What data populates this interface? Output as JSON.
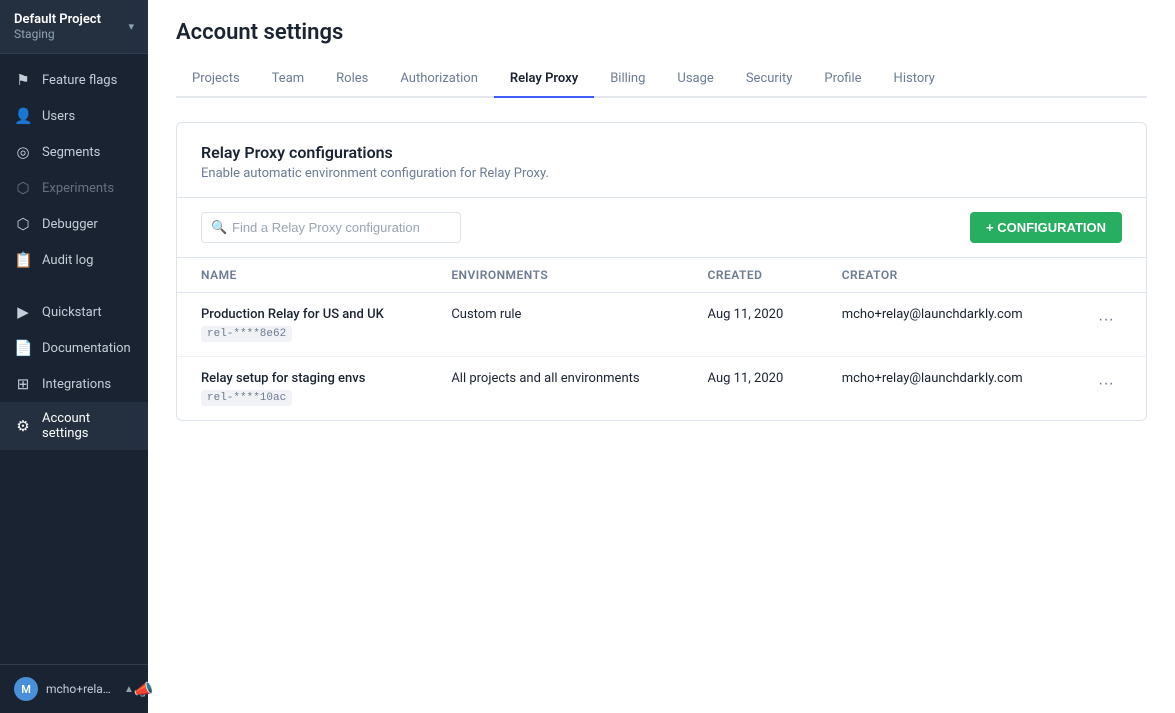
{
  "sidebar": {
    "project": {
      "name": "Default Project",
      "env": "Staging",
      "chevron": "▾"
    },
    "items": [
      {
        "id": "feature-flags",
        "label": "Feature flags",
        "icon": "⚑",
        "active": false,
        "disabled": false
      },
      {
        "id": "users",
        "label": "Users",
        "icon": "👤",
        "active": false,
        "disabled": false
      },
      {
        "id": "segments",
        "label": "Segments",
        "icon": "◎",
        "active": false,
        "disabled": false
      },
      {
        "id": "experiments",
        "label": "Experiments",
        "icon": "🧪",
        "active": false,
        "disabled": true
      },
      {
        "id": "debugger",
        "label": "Debugger",
        "icon": "⬡",
        "active": false,
        "disabled": false
      },
      {
        "id": "audit-log",
        "label": "Audit log",
        "icon": "📋",
        "active": false,
        "disabled": false
      }
    ],
    "bottom_items": [
      {
        "id": "quickstart",
        "label": "Quickstart",
        "icon": "▶"
      },
      {
        "id": "documentation",
        "label": "Documentation",
        "icon": "📄"
      },
      {
        "id": "integrations",
        "label": "Integrations",
        "icon": "⊞"
      },
      {
        "id": "account-settings",
        "label": "Account settings",
        "icon": "⚙",
        "active": true
      }
    ],
    "user": {
      "initials": "M",
      "name": "mcho+relay@l...",
      "chevron": "▲"
    },
    "announce_icon": "📣"
  },
  "page": {
    "title": "Account settings"
  },
  "tabs": [
    {
      "id": "projects",
      "label": "Projects",
      "active": false
    },
    {
      "id": "team",
      "label": "Team",
      "active": false
    },
    {
      "id": "roles",
      "label": "Roles",
      "active": false
    },
    {
      "id": "authorization",
      "label": "Authorization",
      "active": false
    },
    {
      "id": "relay-proxy",
      "label": "Relay Proxy",
      "active": true
    },
    {
      "id": "billing",
      "label": "Billing",
      "active": false
    },
    {
      "id": "usage",
      "label": "Usage",
      "active": false
    },
    {
      "id": "security",
      "label": "Security",
      "active": false
    },
    {
      "id": "profile",
      "label": "Profile",
      "active": false
    },
    {
      "id": "history",
      "label": "History",
      "active": false
    }
  ],
  "relay_proxy": {
    "card_title": "Relay Proxy configurations",
    "card_subtitle": "Enable automatic environment configuration for Relay Proxy.",
    "search_placeholder": "Find a Relay Proxy configuration",
    "add_button_label": "+ CONFIGURATION",
    "table": {
      "columns": [
        {
          "id": "name",
          "label": "Name"
        },
        {
          "id": "environments",
          "label": "Environments"
        },
        {
          "id": "created",
          "label": "Created"
        },
        {
          "id": "creator",
          "label": "Creator"
        }
      ],
      "rows": [
        {
          "name": "Production Relay for US and UK",
          "id_code": "rel-****8e62",
          "environments": "Custom rule",
          "created": "Aug 11, 2020",
          "creator": "mcho+relay@launchdarkly.com"
        },
        {
          "name": "Relay setup for staging envs",
          "id_code": "rel-****10ac",
          "environments": "All projects and all environments",
          "created": "Aug 11, 2020",
          "creator": "mcho+relay@launchdarkly.com"
        }
      ]
    }
  }
}
